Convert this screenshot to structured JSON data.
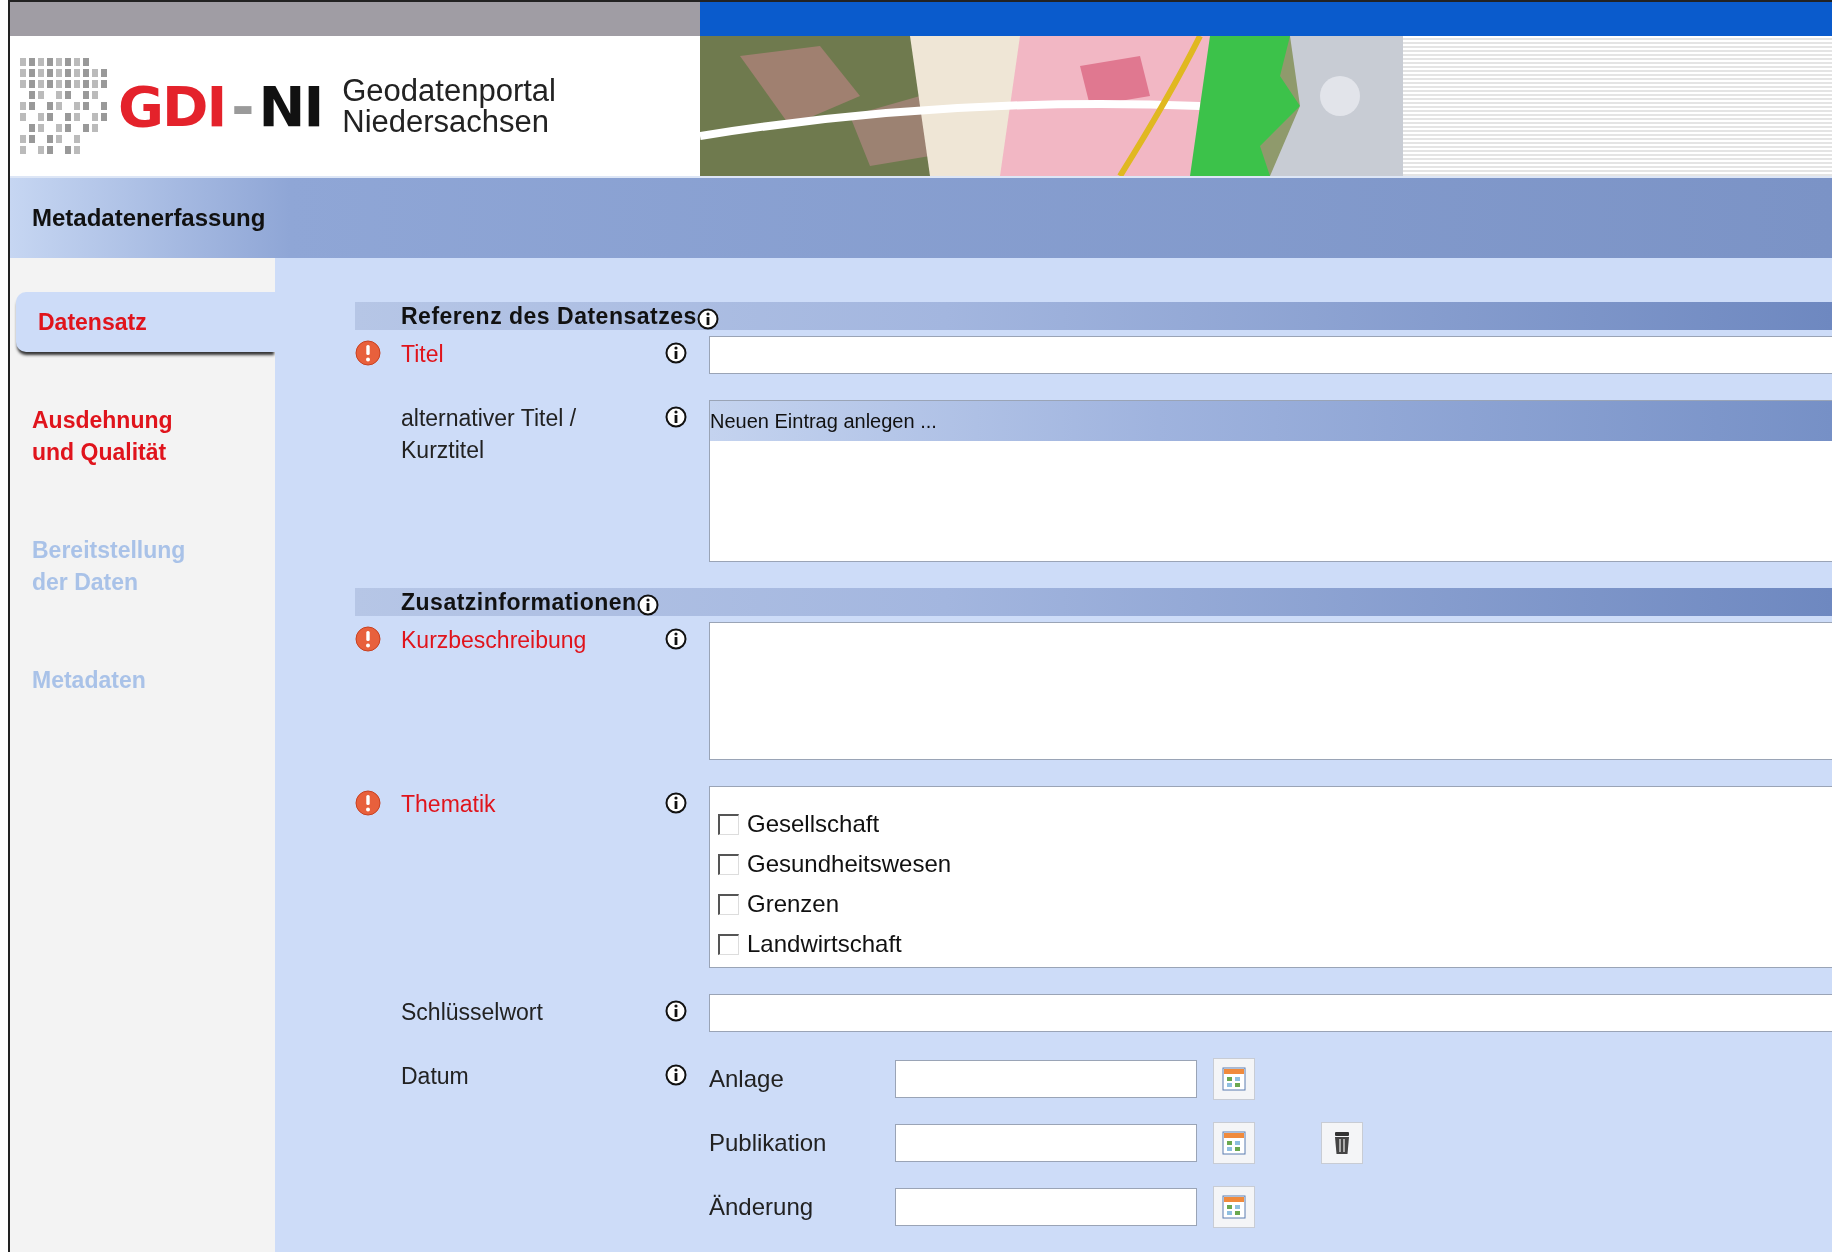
{
  "header": {
    "logo_parts": [
      {
        "text": "GDI",
        "color": "#e4222b"
      },
      {
        "text": "-",
        "color": "#9a9a9a"
      },
      {
        "text": "NI",
        "color": "#111111"
      }
    ],
    "portal_lines": [
      "Geodatenportal",
      "Niedersachsen"
    ],
    "map": {
      "kind": "picture"
    }
  },
  "title_bar": {
    "title": "Metadatenerfassung"
  },
  "sidebar": {
    "items": [
      {
        "label": "Datensatz",
        "selected": true,
        "disabled": false
      },
      {
        "label": "Ausdehnung und Qualität",
        "selected": false,
        "disabled": false
      },
      {
        "label": "Bereitstellung der Daten",
        "selected": false,
        "disabled": true
      },
      {
        "label": "Metadaten",
        "selected": false,
        "disabled": true
      }
    ]
  },
  "sections": [
    {
      "title": "Referenz des Datensatzes",
      "rows": [
        {
          "kind": "text",
          "label": "Titel",
          "required": true
        },
        {
          "kind": "multi",
          "label": "alternativer Titel / Kurztitel",
          "required": false,
          "add_label": "Neuen Eintrag anlegen ..."
        }
      ]
    },
    {
      "title": "Zusatzinformationen",
      "rows": [
        {
          "kind": "textarea",
          "label": "Kurzbeschreibung",
          "required": true
        },
        {
          "kind": "checklist",
          "label": "Thematik",
          "required": true,
          "options": [
            {
              "label": "Gesellschaft",
              "checked": false
            },
            {
              "label": "Gesundheitswesen",
              "checked": false
            },
            {
              "label": "Grenzen",
              "checked": false
            },
            {
              "label": "Landwirtschaft",
              "checked": false
            }
          ]
        },
        {
          "kind": "text",
          "label": "Schlüsselwort",
          "required": false
        },
        {
          "kind": "dates",
          "label": "Datum",
          "required": false,
          "dates": [
            {
              "label": "Anlage"
            },
            {
              "label": "Publikation"
            },
            {
              "label": "Änderung"
            }
          ]
        }
      ]
    }
  ]
}
